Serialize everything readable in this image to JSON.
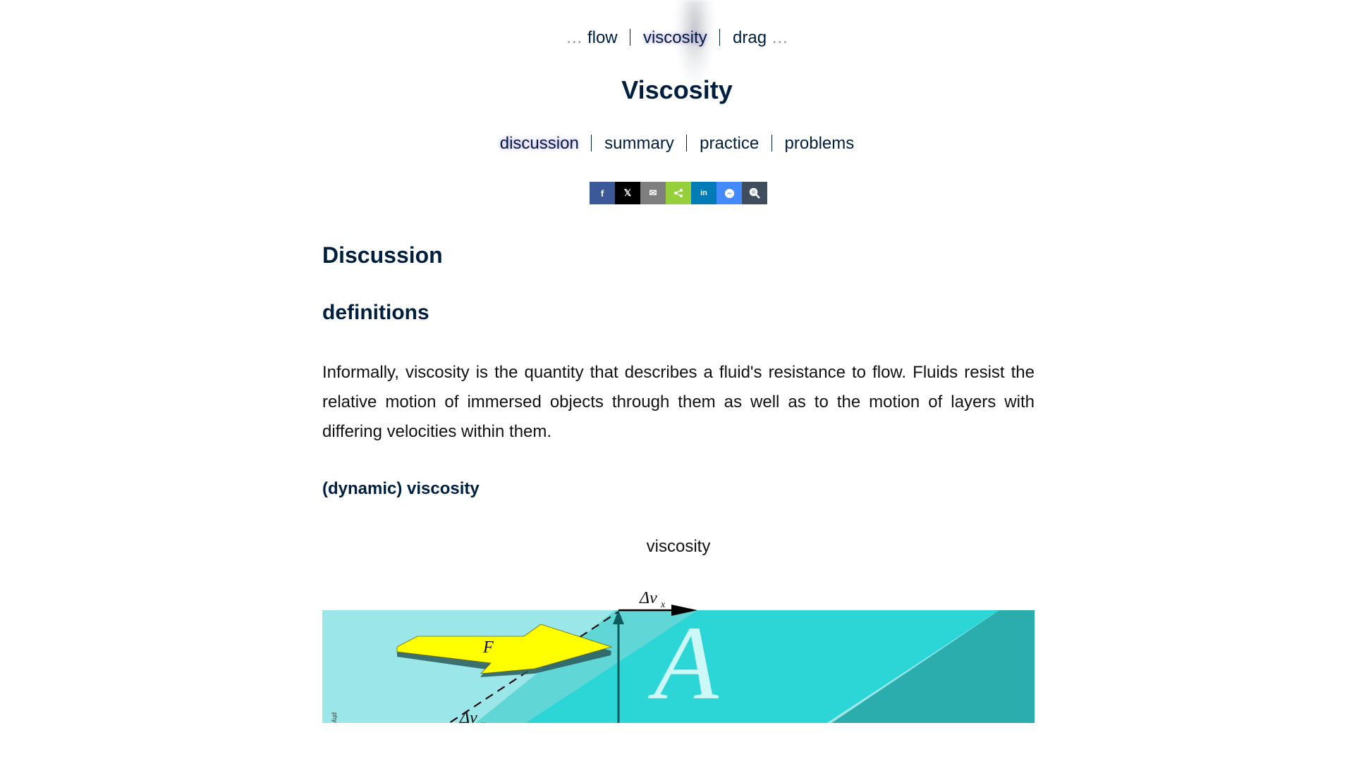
{
  "breadcrumb": {
    "ellipsis_left": "…",
    "prev": "flow",
    "current": "viscosity",
    "next": "drag",
    "ellipsis_right": "…"
  },
  "page": {
    "title": "Viscosity"
  },
  "tabs": [
    "discussion",
    "summary",
    "practice",
    "problems"
  ],
  "active_tab": "discussion",
  "share_buttons": [
    {
      "name": "facebook",
      "icon": "f",
      "color": "#3b5998"
    },
    {
      "name": "x",
      "icon": "𝕏",
      "color": "#000000"
    },
    {
      "name": "email",
      "icon": "✉",
      "color": "#7f7f7f"
    },
    {
      "name": "share",
      "icon": "⋖",
      "color": "#95d03a"
    },
    {
      "name": "linkedin",
      "icon": "in",
      "color": "#007bb5"
    },
    {
      "name": "messenger",
      "icon": "◉",
      "color": "#448aff"
    },
    {
      "name": "search",
      "icon": "🔍",
      "color": "#3f4d5e"
    }
  ],
  "content": {
    "section_title": "Discussion",
    "subsection_title": "definitions",
    "paragraph": "Informally, viscosity is the quantity that describes a fluid's resistance to flow. Fluids resist the relative motion of immersed objects through them as well as to the motion of layers with differing velocities within them.",
    "subsubsection_title": "(dynamic) viscosity"
  },
  "figure": {
    "caption": "viscosity",
    "label_dv_top": "Δv",
    "label_dv_top_sub": "x",
    "label_dv_bottom": "Δv",
    "label_dv_bottom_sub": "x",
    "label_force": "F",
    "label_area": "A",
    "credit": "physics.info",
    "colors": {
      "fluid_light": "#9be6e8",
      "plate_top": "#2dd6d6",
      "plate_side": "#1fa6a6",
      "arrow": "#ffff00"
    }
  }
}
